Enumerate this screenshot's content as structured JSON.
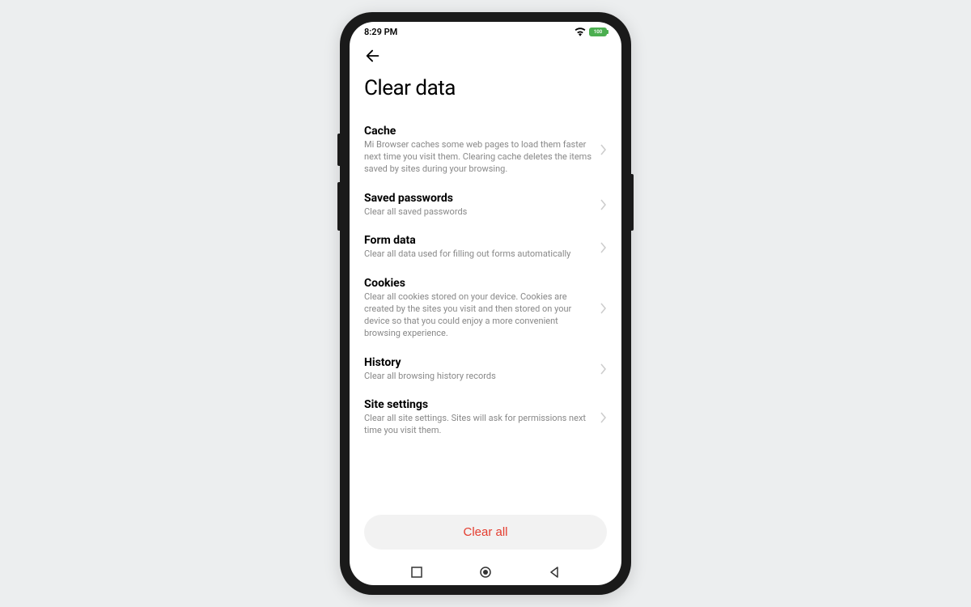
{
  "status_bar": {
    "time": "8:29 PM",
    "battery_text": "100"
  },
  "header": {
    "title": "Clear data"
  },
  "settings": [
    {
      "title": "Cache",
      "desc": "Mi Browser caches some web pages to load them faster next time you visit them. Clearing cache deletes the items saved by sites during your browsing."
    },
    {
      "title": "Saved passwords",
      "desc": "Clear all saved passwords"
    },
    {
      "title": "Form data",
      "desc": "Clear all data used for filling out forms automatically"
    },
    {
      "title": "Cookies",
      "desc": "Clear all cookies stored on your device. Cookies are created by the sites you visit and then stored on your device so that you could enjoy a more convenient browsing experience."
    },
    {
      "title": "History",
      "desc": "Clear all browsing history records"
    },
    {
      "title": "Site settings",
      "desc": "Clear all site settings. Sites will ask for permissions next time you visit them."
    }
  ],
  "footer": {
    "clear_all_label": "Clear all"
  }
}
